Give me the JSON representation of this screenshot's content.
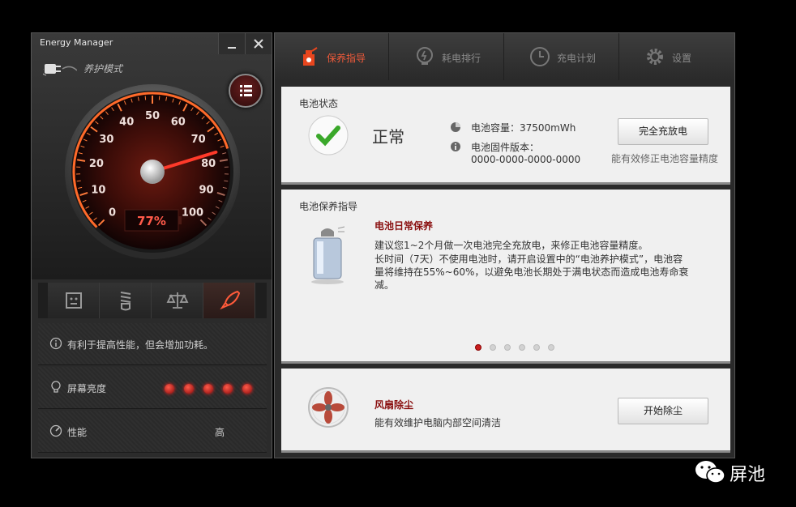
{
  "app": {
    "title": "Energy Manager",
    "mode_label": "养护模式",
    "minimize_icon": "minimize-icon",
    "close_icon": "close-icon"
  },
  "gauge": {
    "percent_text": "77%",
    "percent_value": 77,
    "ticks": [
      "0",
      "10",
      "20",
      "30",
      "40",
      "50",
      "60",
      "70",
      "80",
      "90",
      "100"
    ],
    "accent": "#e8461e"
  },
  "left_tabs": [
    "performance-chip-icon",
    "eco-bulb-icon",
    "balance-scale-icon",
    "rocket-icon"
  ],
  "left_rows": {
    "info": "有利于提高性能，但会增加功耗。",
    "brightness_label": "屏幕亮度",
    "brightness_level": 5,
    "brightness_max": 5,
    "performance_label": "性能",
    "performance_value": "高"
  },
  "nav": {
    "tabs": [
      {
        "label": "保养指导",
        "icon": "maintenance-icon",
        "active": true
      },
      {
        "label": "耗电排行",
        "icon": "bulb-icon",
        "active": false
      },
      {
        "label": "充电计划",
        "icon": "clock-icon",
        "active": false
      },
      {
        "label": "设置",
        "icon": "gear-icon",
        "active": false
      }
    ]
  },
  "battery_status": {
    "title": "电池状态",
    "status": "正常",
    "capacity": "电池容量：37500mWh",
    "firmware_label": "电池固件版本：",
    "firmware_value": "0000-0000-0000-0000",
    "button": "完全充放电",
    "button_hint": "能有效修正电池容量精度"
  },
  "guide": {
    "title": "电池保养指导",
    "heading": "电池日常保养",
    "line1": "建议您1~2个月做一次电池完全充放电，来修正电池容量精度。",
    "line2": "长时间（7天）不使用电池时，请开启设置中的“电池养护模式”，电池容",
    "line3": "量将维持在55%~60%，以避免电池长期处于满电状态而造成电池寿命衰",
    "line4": "减。",
    "page_count": 6,
    "active_page": 1
  },
  "fan": {
    "heading": "风扇除尘",
    "desc": "能有效维护电脑内部空间清洁",
    "button": "开始除尘"
  },
  "watermark": {
    "text": "屏池"
  }
}
